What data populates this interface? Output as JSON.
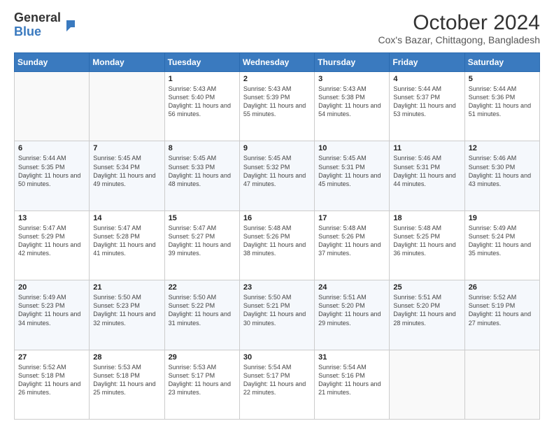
{
  "header": {
    "logo_general": "General",
    "logo_blue": "Blue",
    "title": "October 2024",
    "subtitle": "Cox's Bazar, Chittagong, Bangladesh"
  },
  "weekdays": [
    "Sunday",
    "Monday",
    "Tuesday",
    "Wednesday",
    "Thursday",
    "Friday",
    "Saturday"
  ],
  "weeks": [
    [
      {
        "date": "",
        "info": ""
      },
      {
        "date": "",
        "info": ""
      },
      {
        "date": "1",
        "info": "Sunrise: 5:43 AM\nSunset: 5:40 PM\nDaylight: 11 hours and 56 minutes."
      },
      {
        "date": "2",
        "info": "Sunrise: 5:43 AM\nSunset: 5:39 PM\nDaylight: 11 hours and 55 minutes."
      },
      {
        "date": "3",
        "info": "Sunrise: 5:43 AM\nSunset: 5:38 PM\nDaylight: 11 hours and 54 minutes."
      },
      {
        "date": "4",
        "info": "Sunrise: 5:44 AM\nSunset: 5:37 PM\nDaylight: 11 hours and 53 minutes."
      },
      {
        "date": "5",
        "info": "Sunrise: 5:44 AM\nSunset: 5:36 PM\nDaylight: 11 hours and 51 minutes."
      }
    ],
    [
      {
        "date": "6",
        "info": "Sunrise: 5:44 AM\nSunset: 5:35 PM\nDaylight: 11 hours and 50 minutes."
      },
      {
        "date": "7",
        "info": "Sunrise: 5:45 AM\nSunset: 5:34 PM\nDaylight: 11 hours and 49 minutes."
      },
      {
        "date": "8",
        "info": "Sunrise: 5:45 AM\nSunset: 5:33 PM\nDaylight: 11 hours and 48 minutes."
      },
      {
        "date": "9",
        "info": "Sunrise: 5:45 AM\nSunset: 5:32 PM\nDaylight: 11 hours and 47 minutes."
      },
      {
        "date": "10",
        "info": "Sunrise: 5:45 AM\nSunset: 5:31 PM\nDaylight: 11 hours and 45 minutes."
      },
      {
        "date": "11",
        "info": "Sunrise: 5:46 AM\nSunset: 5:31 PM\nDaylight: 11 hours and 44 minutes."
      },
      {
        "date": "12",
        "info": "Sunrise: 5:46 AM\nSunset: 5:30 PM\nDaylight: 11 hours and 43 minutes."
      }
    ],
    [
      {
        "date": "13",
        "info": "Sunrise: 5:47 AM\nSunset: 5:29 PM\nDaylight: 11 hours and 42 minutes."
      },
      {
        "date": "14",
        "info": "Sunrise: 5:47 AM\nSunset: 5:28 PM\nDaylight: 11 hours and 41 minutes."
      },
      {
        "date": "15",
        "info": "Sunrise: 5:47 AM\nSunset: 5:27 PM\nDaylight: 11 hours and 39 minutes."
      },
      {
        "date": "16",
        "info": "Sunrise: 5:48 AM\nSunset: 5:26 PM\nDaylight: 11 hours and 38 minutes."
      },
      {
        "date": "17",
        "info": "Sunrise: 5:48 AM\nSunset: 5:26 PM\nDaylight: 11 hours and 37 minutes."
      },
      {
        "date": "18",
        "info": "Sunrise: 5:48 AM\nSunset: 5:25 PM\nDaylight: 11 hours and 36 minutes."
      },
      {
        "date": "19",
        "info": "Sunrise: 5:49 AM\nSunset: 5:24 PM\nDaylight: 11 hours and 35 minutes."
      }
    ],
    [
      {
        "date": "20",
        "info": "Sunrise: 5:49 AM\nSunset: 5:23 PM\nDaylight: 11 hours and 34 minutes."
      },
      {
        "date": "21",
        "info": "Sunrise: 5:50 AM\nSunset: 5:23 PM\nDaylight: 11 hours and 32 minutes."
      },
      {
        "date": "22",
        "info": "Sunrise: 5:50 AM\nSunset: 5:22 PM\nDaylight: 11 hours and 31 minutes."
      },
      {
        "date": "23",
        "info": "Sunrise: 5:50 AM\nSunset: 5:21 PM\nDaylight: 11 hours and 30 minutes."
      },
      {
        "date": "24",
        "info": "Sunrise: 5:51 AM\nSunset: 5:20 PM\nDaylight: 11 hours and 29 minutes."
      },
      {
        "date": "25",
        "info": "Sunrise: 5:51 AM\nSunset: 5:20 PM\nDaylight: 11 hours and 28 minutes."
      },
      {
        "date": "26",
        "info": "Sunrise: 5:52 AM\nSunset: 5:19 PM\nDaylight: 11 hours and 27 minutes."
      }
    ],
    [
      {
        "date": "27",
        "info": "Sunrise: 5:52 AM\nSunset: 5:18 PM\nDaylight: 11 hours and 26 minutes."
      },
      {
        "date": "28",
        "info": "Sunrise: 5:53 AM\nSunset: 5:18 PM\nDaylight: 11 hours and 25 minutes."
      },
      {
        "date": "29",
        "info": "Sunrise: 5:53 AM\nSunset: 5:17 PM\nDaylight: 11 hours and 23 minutes."
      },
      {
        "date": "30",
        "info": "Sunrise: 5:54 AM\nSunset: 5:17 PM\nDaylight: 11 hours and 22 minutes."
      },
      {
        "date": "31",
        "info": "Sunrise: 5:54 AM\nSunset: 5:16 PM\nDaylight: 11 hours and 21 minutes."
      },
      {
        "date": "",
        "info": ""
      },
      {
        "date": "",
        "info": ""
      }
    ]
  ]
}
